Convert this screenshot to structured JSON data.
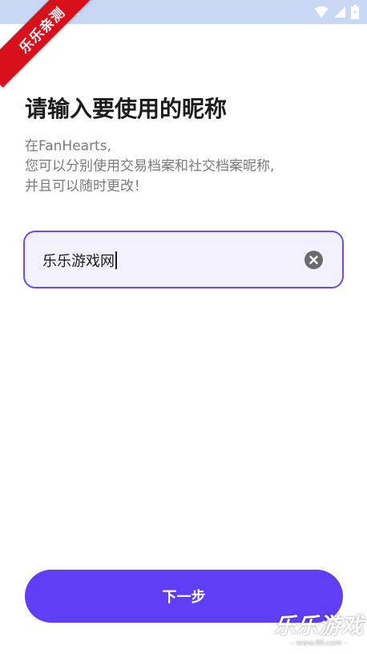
{
  "watermark": {
    "ribbon_text": "乐乐亲测",
    "corner_title": "乐乐游戏",
    "corner_url": "- www.6ll.com -"
  },
  "header": {
    "title": "请输入要使用的昵称"
  },
  "description": {
    "line1": "在FanHearts,",
    "line2": "您可以分别使用交易档案和社交档案昵称,",
    "line3": "并且可以随时更改！"
  },
  "nickname": {
    "value": "乐乐游戏网"
  },
  "footer": {
    "next_label": "下一步"
  },
  "colors": {
    "accent": "#5e3ff5",
    "input_border": "#6a4fe6",
    "input_bg": "#f3f1fd",
    "status_bar": "#c9d9f5"
  },
  "icons": [
    "back-arrow-icon",
    "clear-icon",
    "wifi-icon",
    "signal-icon",
    "battery-icon"
  ]
}
